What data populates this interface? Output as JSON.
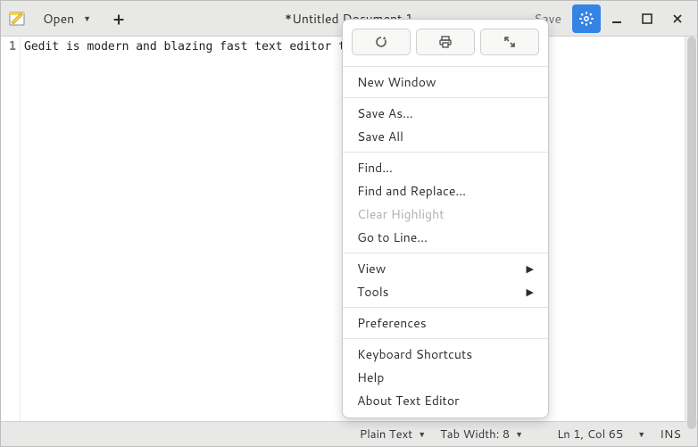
{
  "titlebar": {
    "open_label": "Open",
    "title": "*Untitled Document 1",
    "save_label": "Save"
  },
  "editor": {
    "line_number": "1",
    "text": "Gedit is modern and blazing fast text editor that supports C++!"
  },
  "menu": {
    "new_window": "New Window",
    "save_as": "Save As…",
    "save_all": "Save All",
    "find": "Find…",
    "find_replace": "Find and Replace…",
    "clear_highlight": "Clear Highlight",
    "goto_line": "Go to Line…",
    "view": "View",
    "tools": "Tools",
    "preferences": "Preferences",
    "shortcuts": "Keyboard Shortcuts",
    "help": "Help",
    "about": "About Text Editor"
  },
  "statusbar": {
    "syntax": "Plain Text",
    "tab_width": "Tab Width: 8",
    "position": "Ln 1, Col 65",
    "ins": "INS"
  }
}
